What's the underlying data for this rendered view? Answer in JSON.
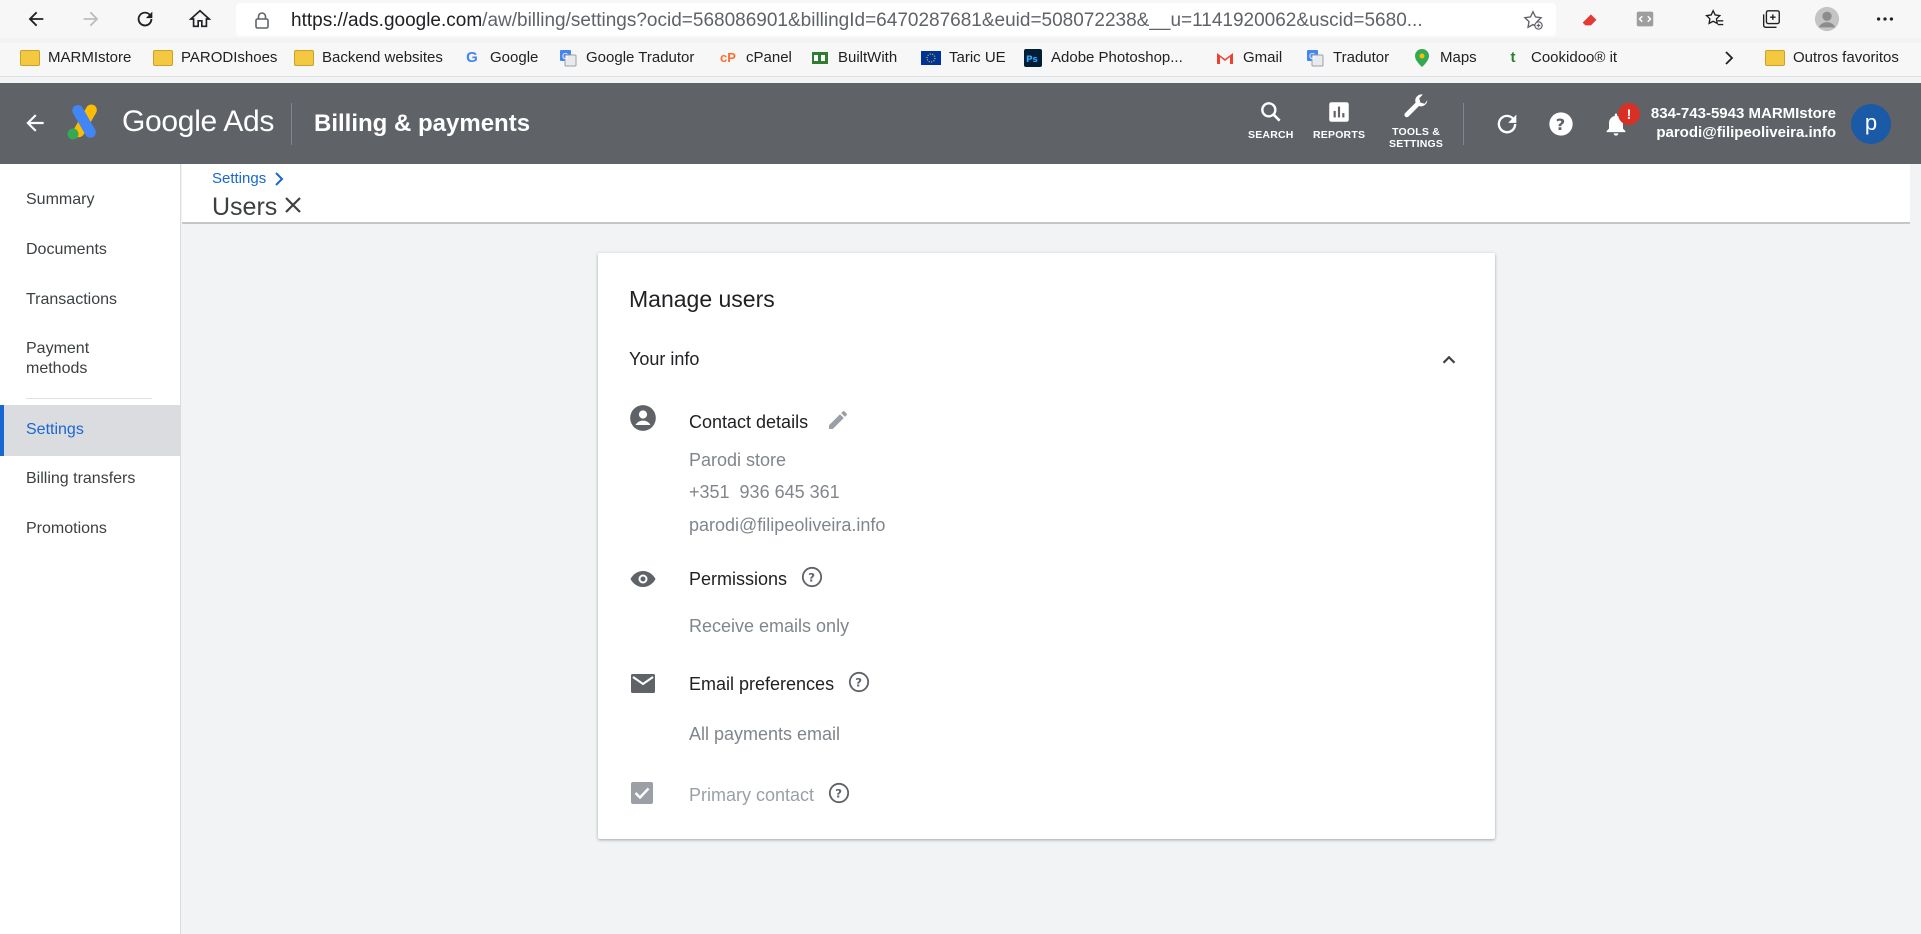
{
  "browser": {
    "url_host": "https://ads.google.com",
    "url_path": "/aw/billing/settings?ocid=568086901&billingId=6470287681&euid=508072238&__u=1141920062&uscid=5680...",
    "bookmarks": [
      {
        "label": "MARMIstore",
        "icon": "folder-icon"
      },
      {
        "label": "PARODIshoes",
        "icon": "folder-icon"
      },
      {
        "label": "Backend websites",
        "icon": "folder-icon"
      },
      {
        "label": "Google",
        "icon": "google-icon"
      },
      {
        "label": "Google Tradutor",
        "icon": "translate-icon"
      },
      {
        "label": "cPanel",
        "icon": "cpanel-icon"
      },
      {
        "label": "BuiltWith",
        "icon": "builtwith-icon"
      },
      {
        "label": "Taric UE",
        "icon": "eu-flag-icon"
      },
      {
        "label": "Adobe Photoshop...",
        "icon": "photoshop-icon"
      },
      {
        "label": "Gmail",
        "icon": "gmail-icon"
      },
      {
        "label": "Tradutor",
        "icon": "translate-icon"
      },
      {
        "label": "Maps",
        "icon": "maps-icon"
      },
      {
        "label": "Cookidoo® it",
        "icon": "cookidoo-icon"
      }
    ],
    "other_favorites": "Outros favoritos"
  },
  "header": {
    "brand": "Google Ads",
    "title": "Billing & payments",
    "tools": {
      "search": "SEARCH",
      "reports": "REPORTS",
      "tools_line1": "TOOLS &",
      "tools_line2": "SETTINGS"
    },
    "notification_badge": "!",
    "account_line1": "834-743-5943 MARMIstore",
    "account_line2": "parodi@filipeoliveira.info",
    "avatar_letter": "p"
  },
  "sidebar": {
    "items": [
      {
        "label": "Summary"
      },
      {
        "label": "Documents"
      },
      {
        "label": "Transactions"
      },
      {
        "label": "Payment methods"
      },
      {
        "label": "Settings"
      },
      {
        "label": "Billing transfers"
      },
      {
        "label": "Promotions"
      }
    ],
    "active": "Settings"
  },
  "page": {
    "breadcrumb": "Settings",
    "title": "Users"
  },
  "card": {
    "title": "Manage users",
    "section": "Your info",
    "contact": {
      "label": "Contact details",
      "name": "Parodi store",
      "phone": "+351  936 645 361",
      "email": "parodi@filipeoliveira.info"
    },
    "permissions": {
      "label": "Permissions",
      "value": "Receive emails only"
    },
    "email_prefs": {
      "label": "Email preferences",
      "value": "All payments email"
    },
    "primary_contact": {
      "label": "Primary contact",
      "checked": true
    }
  },
  "colors": {
    "header_bg": "#5f6368",
    "accent": "#1967d2",
    "avatar": "#1a5aa6",
    "badge": "#d93025"
  }
}
